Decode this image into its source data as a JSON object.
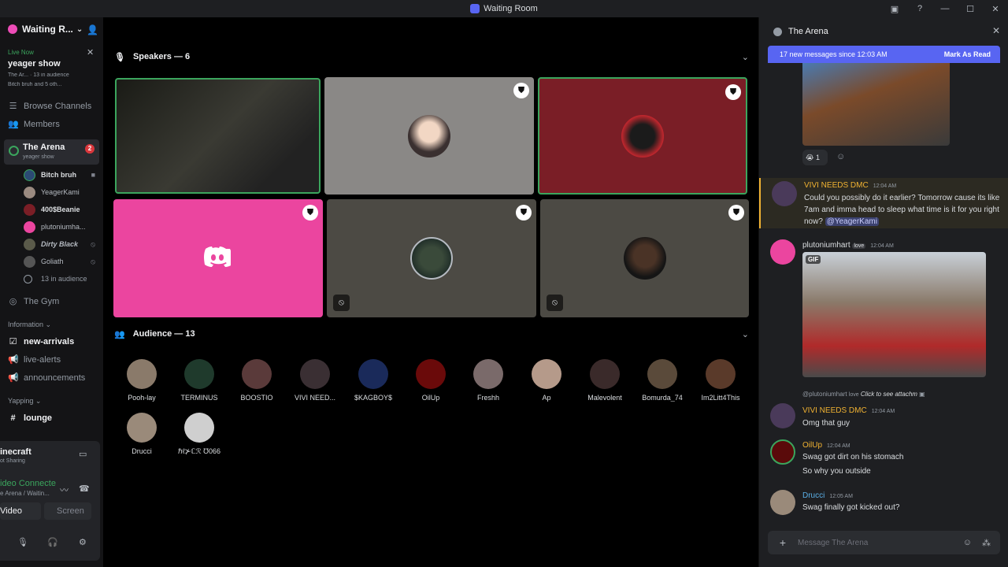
{
  "window": {
    "title": "Waiting Room"
  },
  "sidebar": {
    "server_name": "Waiting R...",
    "live_badge": "Live Now",
    "live_title": "yeager show",
    "live_meta": "The Ar... · 13 in audience",
    "live_speakers": "Bitch bruh and 5 oth...",
    "nav": [
      {
        "label": "Browse Channels"
      },
      {
        "label": "Members"
      }
    ],
    "stage_channel": {
      "name": "The Arena",
      "subtitle": "yeager show",
      "badge": "2"
    },
    "stage_members": [
      {
        "name": "Bitch bruh"
      },
      {
        "name": "YeagerKami"
      },
      {
        "name": "400$Beanie"
      },
      {
        "name": "plutoniumha..."
      },
      {
        "name": "Dirty Black"
      },
      {
        "name": "Goliath"
      },
      {
        "name": "13 in audience"
      }
    ],
    "gym": "The Gym",
    "category_info": "Information",
    "channels_info": [
      {
        "label": "new-arrivals"
      },
      {
        "label": "live-alerts"
      },
      {
        "label": "announcements"
      }
    ],
    "category_yapping": "Yapping",
    "channel_lounge": "lounge",
    "activity": {
      "title": "inecraft",
      "sub": "ot Sharing"
    },
    "voice": {
      "status": "ideo Connecte",
      "location": "e Arena / Waitin...",
      "video_btn": "Video",
      "screen_btn": "Screen"
    }
  },
  "main": {
    "speakers_header": "Speakers — 6",
    "audience_header": "Audience — 13",
    "audience": [
      {
        "name": "Pooh-lay"
      },
      {
        "name": "TERMINUS"
      },
      {
        "name": "BOOSTIO"
      },
      {
        "name": "VIVI NEED..."
      },
      {
        "name": "$KAGBOY$"
      },
      {
        "name": "OilUp"
      },
      {
        "name": "Freshh"
      },
      {
        "name": "Ap"
      },
      {
        "name": "Malevolent"
      },
      {
        "name": "Bomurda_74"
      },
      {
        "name": "Im2Litt4This"
      },
      {
        "name": "Drucci"
      },
      {
        "name": "ℏℓ⊁ℂℛ ℧066"
      }
    ]
  },
  "chat": {
    "title": "The Arena",
    "new_messages": "17 new messages since 12:03 AM",
    "mark_read": "Mark As Read",
    "reaction_count": "1",
    "messages": [
      {
        "author": "VIVI NEEDS DMC",
        "time": "12:04 AM",
        "text": "Could you possibly do it earlier? Tomorrow cause its like 7am and imma head to sleep what time is it for you right now?",
        "mention": "@YeagerKami"
      },
      {
        "author": "plutoniumhart",
        "tag": "love",
        "time": "12:04 AM",
        "gif": "GIF"
      },
      {
        "reply": "@plutoniumhart",
        "reply_tag": "love",
        "reply_text": "Click to see attachm",
        "author": "VIVI NEEDS DMC",
        "time": "12:04 AM",
        "text": "Omg that guy"
      },
      {
        "author": "OilUp",
        "time": "12:04 AM",
        "text": "Swag got dirt on his stomach",
        "text2": "So why you outside"
      },
      {
        "author": "Drucci",
        "time": "12:05 AM",
        "text": "Swag finally got kicked out?"
      }
    ],
    "composer_placeholder": "Message The Arena"
  },
  "colors": {
    "accent": "#5865f2",
    "speaking": "#3ba55d",
    "pink_tile": "#eb459f",
    "red_tile": "#7a1e26"
  }
}
